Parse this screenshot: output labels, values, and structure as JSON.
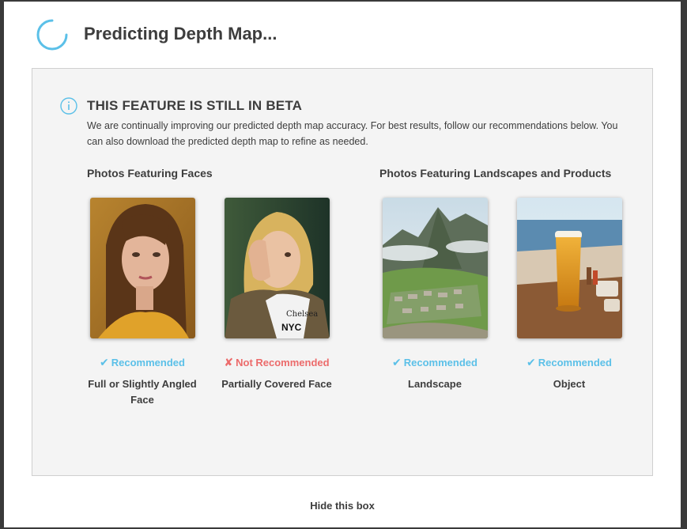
{
  "header": {
    "title": "Predicting Depth Map..."
  },
  "beta": {
    "heading": "THIS FEATURE IS STILL IN BETA",
    "description": "We are continually improving our predicted depth map accuracy. For best results, follow our recommendations below. You can also download the predicted depth map to refine as needed."
  },
  "groups": {
    "faces_title": "Photos Featuring Faces",
    "landscapes_title": "Photos Featuring Landscapes and Products"
  },
  "cards": [
    {
      "status_mark": "✔",
      "status": "Recommended",
      "caption": "Full or Slightly Angled Face",
      "image": "portrait-photo"
    },
    {
      "status_mark": "✘",
      "status": "Not Recommended",
      "caption": "Partially Covered Face",
      "image": "covered-face-photo"
    },
    {
      "status_mark": "✔",
      "status": "Recommended",
      "caption": "Landscape",
      "image": "landscape-photo"
    },
    {
      "status_mark": "✔",
      "status": "Recommended",
      "caption": "Object",
      "image": "object-photo"
    }
  ],
  "footer": {
    "hide_label": "Hide this box"
  },
  "colors": {
    "accent": "#5bc0e8",
    "not_recommended": "#ec6b6b",
    "text": "#3d3d3d",
    "panel_bg": "#f4f4f4"
  },
  "icons": {
    "spinner": "loading-spinner-icon",
    "info": "info-icon"
  }
}
